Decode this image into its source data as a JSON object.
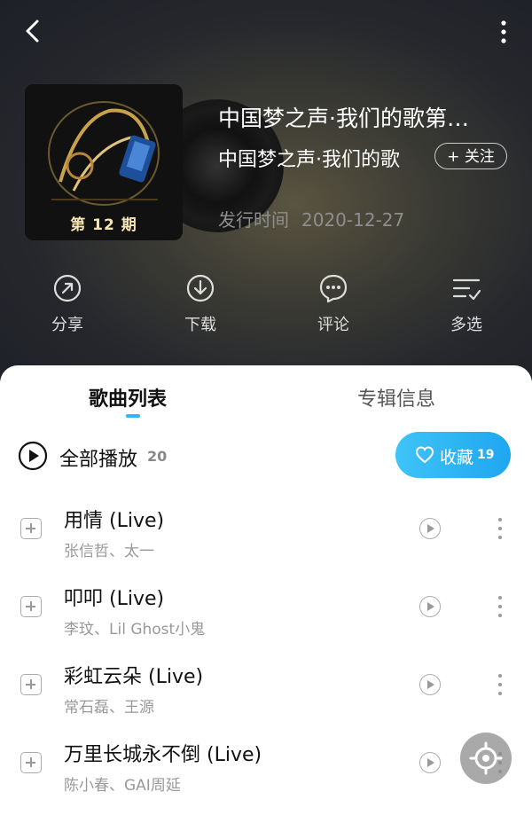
{
  "header": {
    "album_title": "中国梦之声·我们的歌第…",
    "artist": "中国梦之声·我们的歌",
    "follow_label": "+ 关注",
    "release_label": "发行时间",
    "release_date": "2020-12-27",
    "cover_text": "第 12 期"
  },
  "actions": [
    {
      "label": "分享",
      "icon": "share-icon"
    },
    {
      "label": "下载",
      "icon": "download-icon"
    },
    {
      "label": "评论",
      "icon": "comment-icon"
    },
    {
      "label": "多选",
      "icon": "multiselect-icon"
    }
  ],
  "tabs": [
    {
      "label": "歌曲列表",
      "active": true
    },
    {
      "label": "专辑信息",
      "active": false
    }
  ],
  "playall": {
    "label": "全部播放",
    "count": "20"
  },
  "collect": {
    "label": "收藏",
    "count": "19"
  },
  "songs": [
    {
      "title": "用情 (Live)",
      "artists": "张信哲、太一"
    },
    {
      "title": "叩叩 (Live)",
      "artists": "李玟、Lil Ghost小鬼"
    },
    {
      "title": "彩虹云朵 (Live)",
      "artists": "常石磊、王源"
    },
    {
      "title": "万里长城永不倒 (Live)",
      "artists": "陈小春、GAI周延"
    }
  ],
  "colors": {
    "accent": "#2fb6f5",
    "header_bg": "#25272c"
  }
}
